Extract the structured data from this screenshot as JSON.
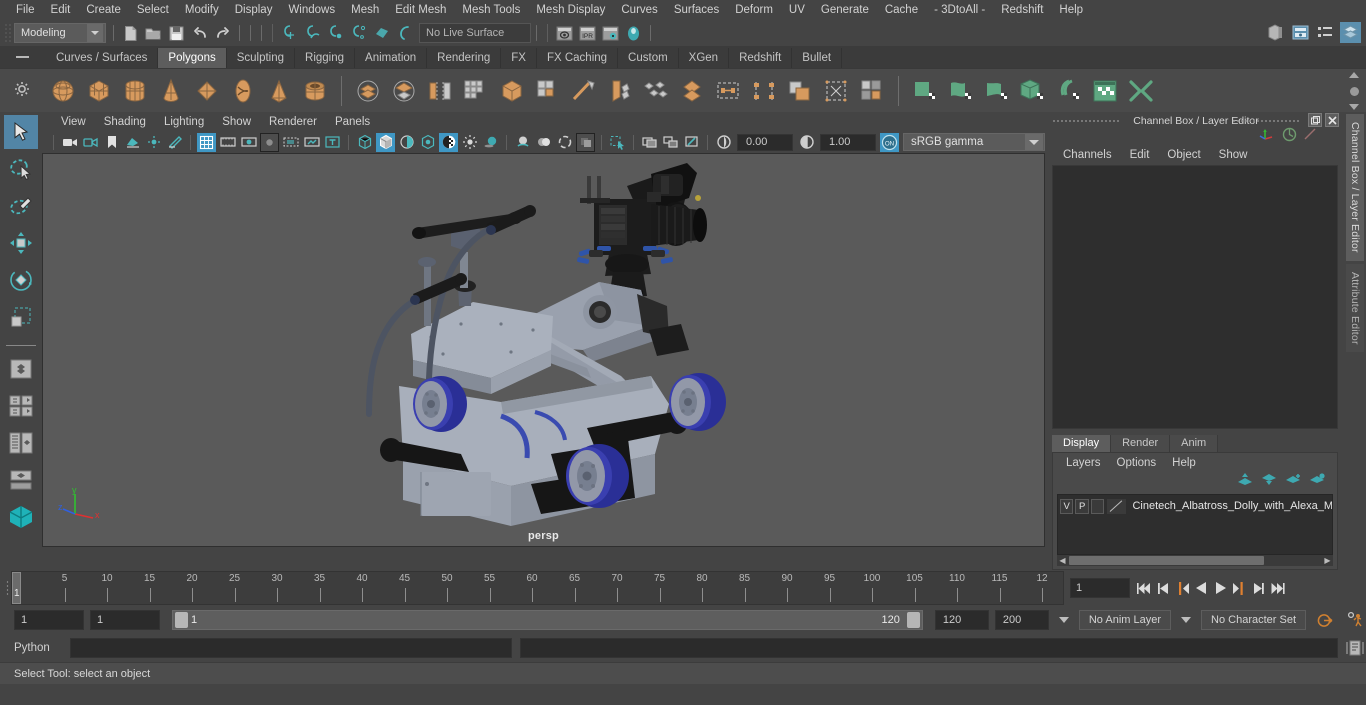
{
  "menubar": {
    "items": [
      "File",
      "Edit",
      "Create",
      "Select",
      "Modify",
      "Display",
      "Windows",
      "Mesh",
      "Edit Mesh",
      "Mesh Tools",
      "Mesh Display",
      "Curves",
      "Surfaces",
      "Deform",
      "UV",
      "Generate",
      "Cache",
      "- 3DtoAll -",
      "Redshift",
      "Help"
    ]
  },
  "statusline": {
    "workspace": "Modeling",
    "live_surface": "No Live Surface",
    "icons": [
      "new-scene-icon",
      "open-scene-icon",
      "save-scene-icon",
      "undo-icon",
      "redo-icon",
      "snap-grid-icon",
      "snap-curve-icon",
      "snap-point-icon",
      "snap-projected-center-icon",
      "snap-view-plane-icon",
      "make-live-icon",
      "render-current-frame-icon",
      "ipr-render-icon",
      "render-settings-icon",
      "rendering-flags-icon"
    ],
    "right_icons": [
      "show-hide-modeling-toolkit-icon",
      "show-hide-attribute-editor-icon",
      "show-hide-tool-settings-icon",
      "show-hide-channel-box-icon"
    ]
  },
  "shelf": {
    "tabs": [
      "Curves / Surfaces",
      "Polygons",
      "Sculpting",
      "Rigging",
      "Animation",
      "Rendering",
      "FX",
      "FX Caching",
      "Custom",
      "XGen",
      "Redshift",
      "Bullet"
    ],
    "active_tab": "Polygons",
    "buttons": [
      {
        "name": "poly-sphere",
        "color": "#d79a5e",
        "shape": "sphere"
      },
      {
        "name": "poly-cube",
        "color": "#d79a5e",
        "shape": "cube"
      },
      {
        "name": "poly-cylinder",
        "color": "#d79a5e",
        "shape": "cylinder"
      },
      {
        "name": "poly-cone",
        "color": "#d79a5e",
        "shape": "cone"
      },
      {
        "name": "poly-plane",
        "color": "#d79a5e",
        "shape": "plane"
      },
      {
        "name": "poly-torus",
        "color": "#d79a5e",
        "shape": "torus"
      },
      {
        "name": "poly-prism",
        "color": "#d79a5e",
        "shape": "prism"
      },
      {
        "name": "poly-pipe",
        "color": "#d79a5e",
        "shape": "pipe"
      },
      {
        "name": "poly-combine",
        "color": "#d79a5e",
        "shape": "combine"
      },
      {
        "name": "poly-separate",
        "color": "#d79a5e",
        "shape": "separate"
      },
      {
        "name": "poly-mirror",
        "color": "#bdbdbd",
        "shape": "mirror"
      },
      {
        "name": "poly-smooth",
        "color": "#bdbdbd",
        "shape": "smooth"
      },
      {
        "name": "poly-reduce",
        "color": "#d79a5e",
        "shape": "reduce"
      },
      {
        "name": "poly-extract",
        "color": "#bdbdbd",
        "shape": "extract"
      },
      {
        "name": "poly-bevel",
        "color": "#bdbdbd",
        "shape": "bevel"
      },
      {
        "name": "poly-extrude",
        "color": "#d79a5e",
        "shape": "extrude"
      },
      {
        "name": "poly-merge",
        "color": "#bdbdbd",
        "shape": "merge"
      },
      {
        "name": "poly-append",
        "color": "#d79a5e",
        "shape": "append"
      },
      {
        "name": "poly-bridge",
        "color": "#bdbdbd",
        "shape": "bridge"
      },
      {
        "name": "poly-wedge",
        "color": "#bdbdbd",
        "shape": "wedge"
      },
      {
        "name": "poly-boolean",
        "color": "#d79a5e",
        "shape": "boolean"
      },
      {
        "name": "poly-fill-hole",
        "color": "#bdbdbd",
        "shape": "fillhole"
      },
      {
        "name": "nurbs-plane",
        "color": "#5fa882",
        "shape": "nplane"
      },
      {
        "name": "nurbs-surface",
        "color": "#5fa882",
        "shape": "nsurface"
      },
      {
        "name": "nurbs-loft",
        "color": "#5fa882",
        "shape": "nloft"
      },
      {
        "name": "nurbs-cube",
        "color": "#5fa882",
        "shape": "ncube"
      },
      {
        "name": "nurbs-revolve",
        "color": "#5fa882",
        "shape": "nrevolve"
      },
      {
        "name": "uv-editor",
        "color": "#5fa882",
        "shape": "uveditor"
      },
      {
        "name": "uv-unfold",
        "color": "#5fa882",
        "shape": "uvunfold"
      }
    ]
  },
  "toolbox": {
    "items": [
      {
        "name": "select-tool",
        "selected": true
      },
      {
        "name": "lasso-select-tool",
        "selected": false
      },
      {
        "name": "paint-select-tool",
        "selected": false
      },
      {
        "name": "move-tool",
        "selected": false
      },
      {
        "name": "rotate-tool",
        "selected": false
      },
      {
        "name": "scale-tool",
        "selected": false
      },
      {
        "name": "last-tool-used",
        "selected": false
      },
      {
        "name": "layout-four-view",
        "selected": false
      },
      {
        "name": "layout-persp-outliner",
        "selected": false
      },
      {
        "name": "layout-single-persp",
        "selected": false
      },
      {
        "name": "layout-hypershade",
        "selected": false
      }
    ]
  },
  "viewport": {
    "menus": [
      "View",
      "Shading",
      "Lighting",
      "Show",
      "Renderer",
      "Panels"
    ],
    "camera_label": "persp",
    "exposure": "0.00",
    "gamma_value": "1.00",
    "color_management": "sRGB gamma",
    "axis_labels": {
      "x": "x",
      "y": "y",
      "z": "z"
    },
    "axis_colors": {
      "x": "#e03030",
      "y": "#30c030",
      "z": "#3060e0"
    },
    "background": "#5a5a5a",
    "model": {
      "name": "Cinetech Albatross Dolly with Alexa Mini camera",
      "body_color": "#9aa1ae",
      "wheel_color": "#2e2f8c",
      "camera_color": "#181818"
    }
  },
  "channelbox": {
    "panel_title": "Channel Box / Layer Editor",
    "menus": [
      "Channels",
      "Edit",
      "Object",
      "Show"
    ],
    "side_tabs": [
      "Channel Box / Layer Editor",
      "Attribute Editor"
    ],
    "layer_tabs": [
      "Display",
      "Render",
      "Anim"
    ],
    "active_layer_tab": "Display",
    "layer_menus": [
      "Layers",
      "Options",
      "Help"
    ],
    "layers": [
      {
        "visibility": "V",
        "playback": "P",
        "reference": "",
        "name": "Cinetech_Albatross_Dolly_with_Alexa_Min"
      }
    ]
  },
  "timeline": {
    "tick_labels": [
      "5",
      "10",
      "15",
      "20",
      "25",
      "30",
      "35",
      "40",
      "45",
      "50",
      "55",
      "60",
      "65",
      "70",
      "75",
      "80",
      "85",
      "90",
      "95",
      "100",
      "105",
      "110",
      "115",
      "12"
    ],
    "current_frame_marker": "1",
    "current_frame_field": "1",
    "playback_buttons": [
      "go-to-start-icon",
      "step-back-frame-icon",
      "step-back-key-icon",
      "play-backwards-icon",
      "play-forwards-icon",
      "step-forward-key-icon",
      "step-forward-frame-icon",
      "go-to-end-icon"
    ]
  },
  "rangeslider": {
    "anim_start": "1",
    "range_start": "1",
    "bar_start_label": "1",
    "bar_end_label": "120",
    "range_end": "120",
    "anim_end": "200",
    "anim_layer": "No Anim Layer",
    "character_set": "No Character Set",
    "icons": [
      "auto-keyframe-icon",
      "animation-preferences-icon"
    ]
  },
  "commandline": {
    "language_label": "Python",
    "input_value": "",
    "result_value": "",
    "script_editor_icon": "script-editor-icon"
  },
  "helpline": {
    "text": "Select Tool: select an object"
  },
  "theme": {
    "bg": "#444444",
    "panel_dark": "#2e2e2e",
    "accent_blue": "#3f97c4",
    "accent_teal": "#4bb8bd",
    "shelf_orange": "#d79a5e",
    "shelf_green": "#5fa882"
  }
}
